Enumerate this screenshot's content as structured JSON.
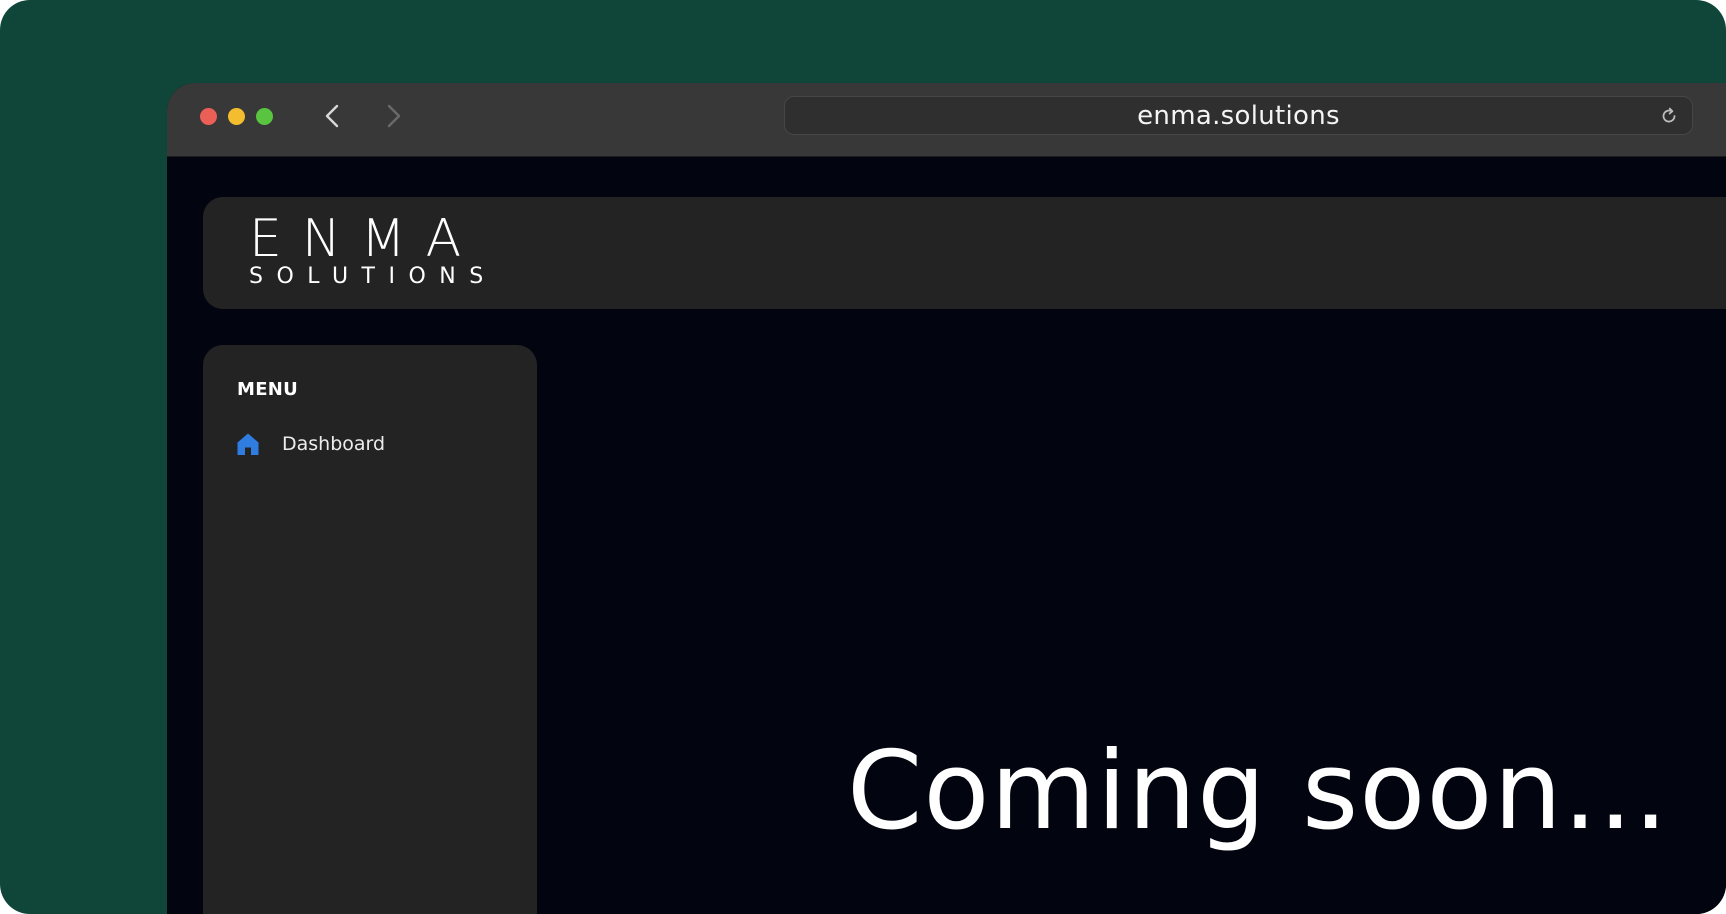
{
  "browser": {
    "url": "enma.solutions",
    "controls": {
      "close_color": "#ec5f57",
      "minimize_color": "#f3bd2f",
      "maximize_color": "#58c43f",
      "back_icon": "chevron-left-icon",
      "forward_icon": "chevron-right-icon",
      "reload_icon": "reload-icon"
    }
  },
  "header": {
    "logo_top": "ENMA",
    "logo_bottom": "SOLUTIONS"
  },
  "sidebar": {
    "title": "MENU",
    "items": [
      {
        "label": "Dashboard",
        "icon": "home-icon",
        "icon_color": "#2f7de1"
      }
    ]
  },
  "main": {
    "message": "Coming soon..."
  },
  "colors": {
    "outer_background": "#10463a",
    "page_background": "#02050f",
    "panel_background": "#232323",
    "titlebar_background": "#383838"
  }
}
